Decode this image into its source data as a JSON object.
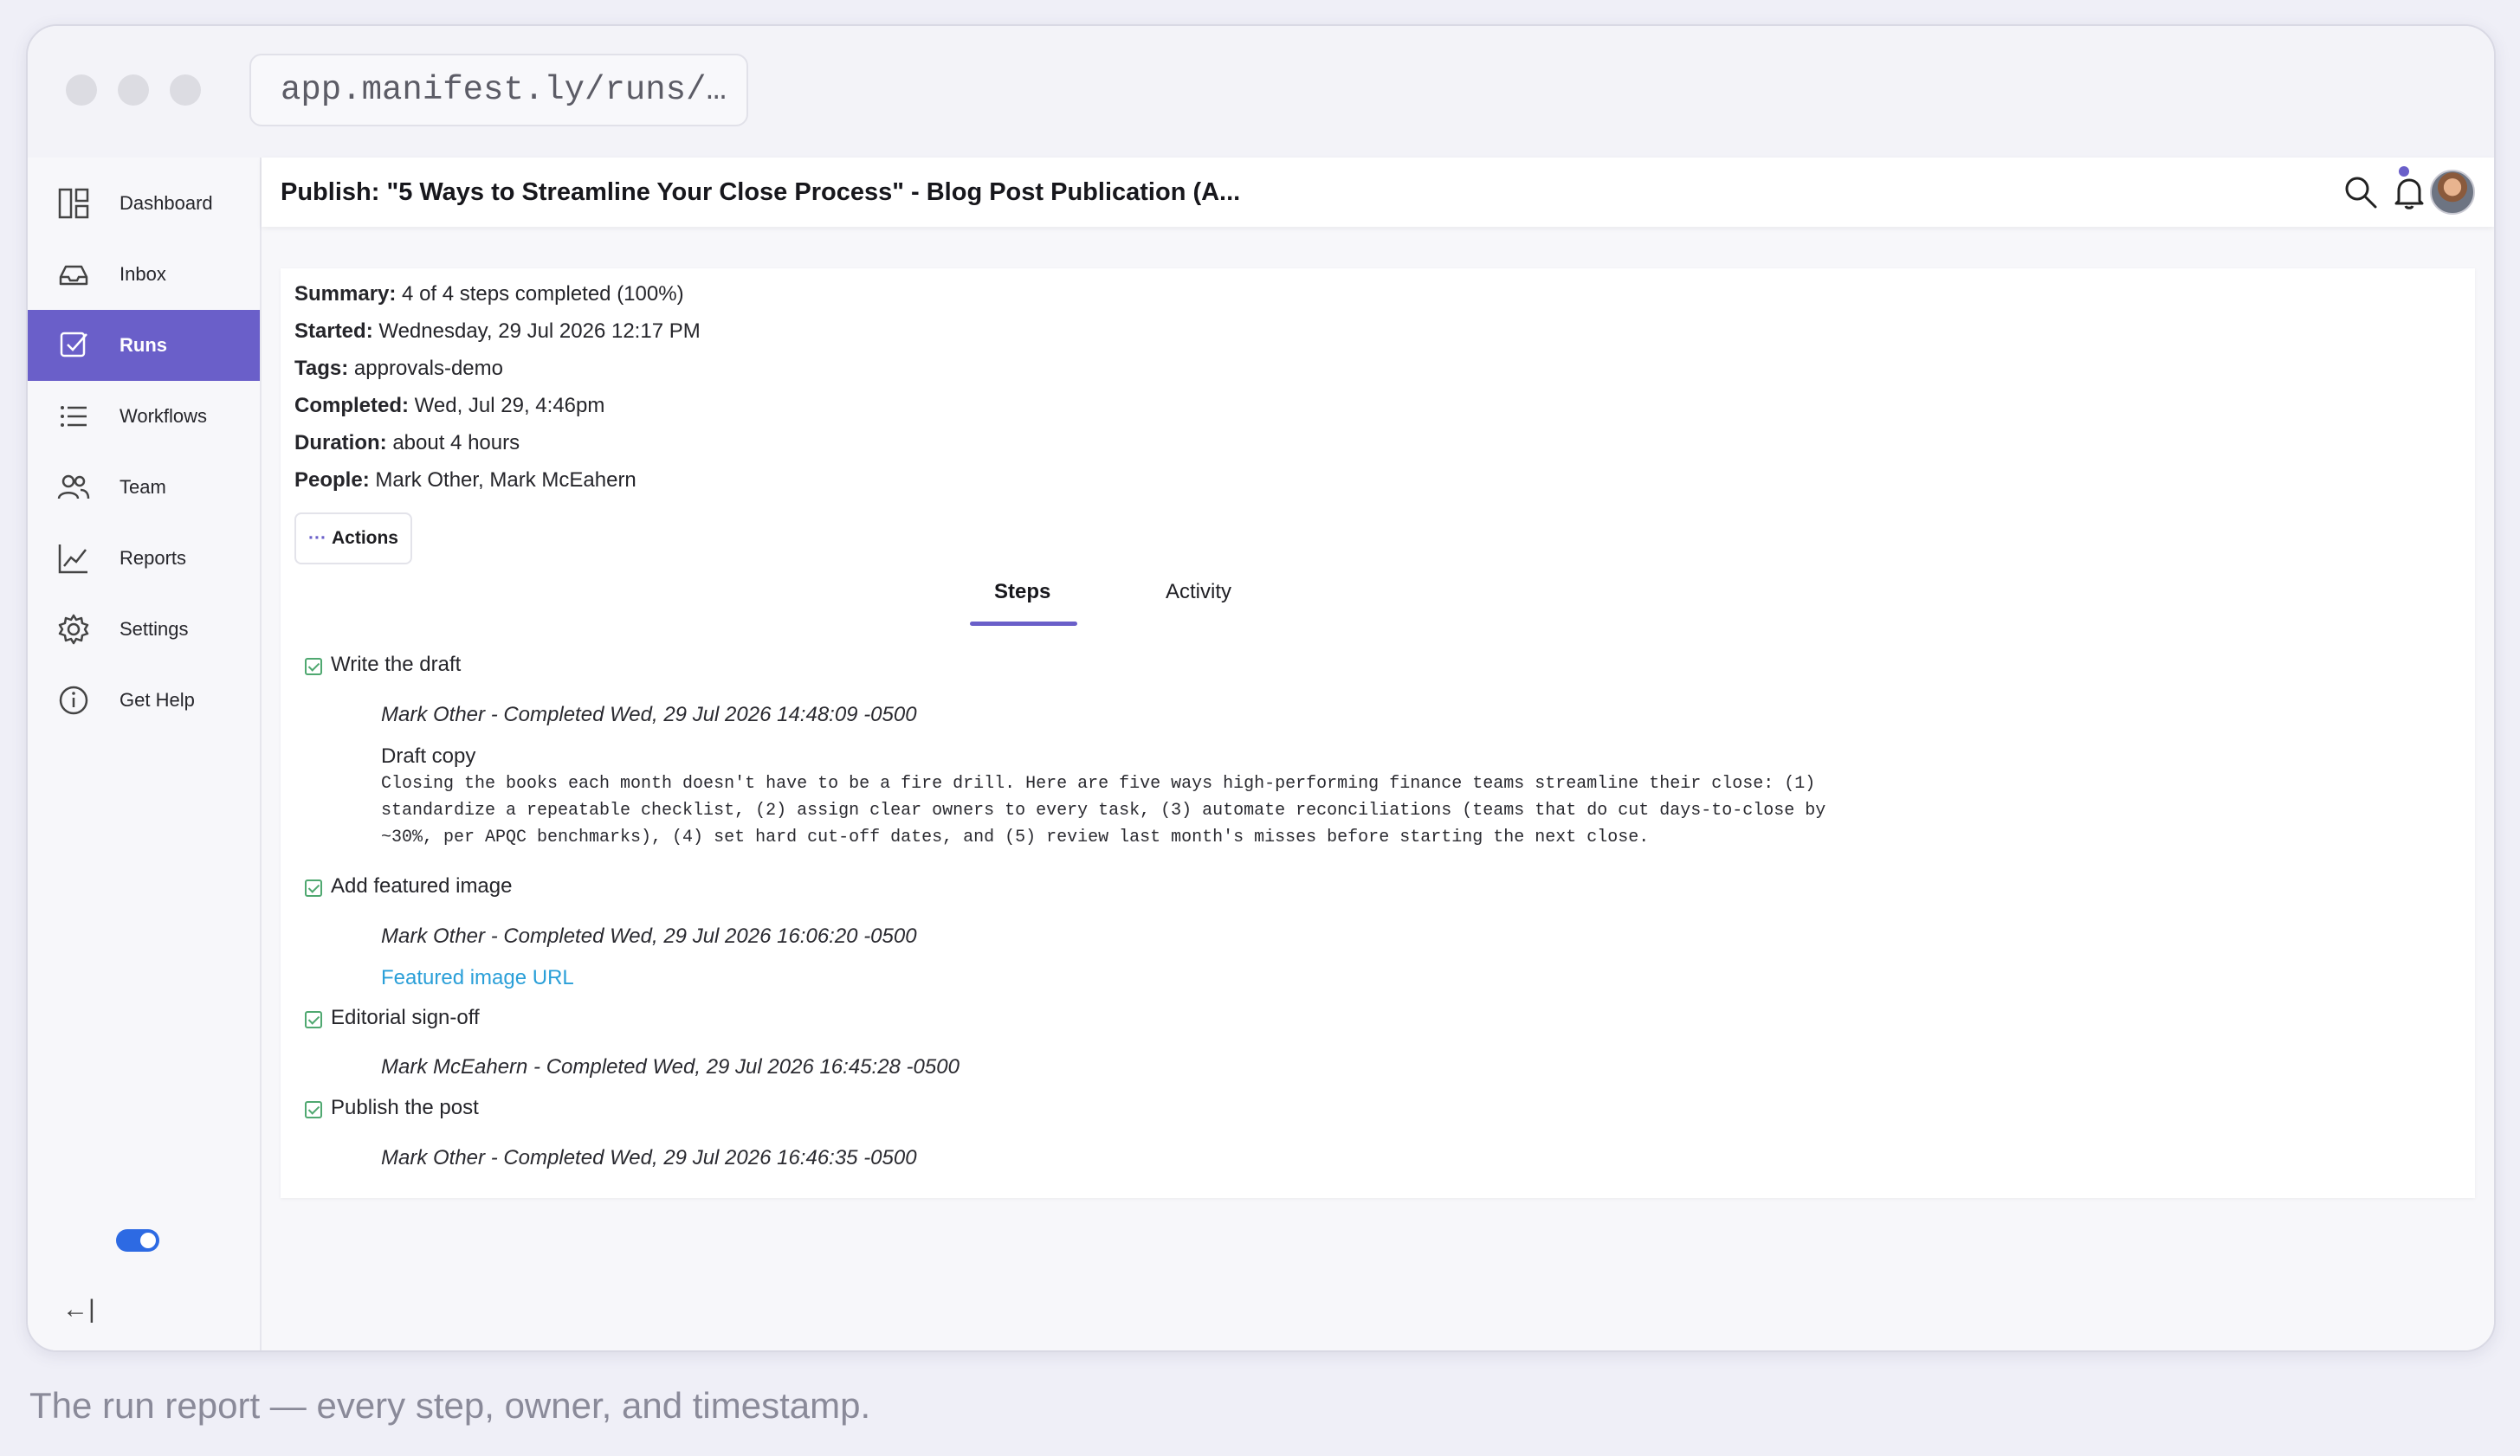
{
  "browser": {
    "url": "app.manifest.ly/runs/…"
  },
  "sidebar": {
    "items": [
      {
        "label": "Dashboard",
        "icon": "dashboard-icon"
      },
      {
        "label": "Inbox",
        "icon": "inbox-icon"
      },
      {
        "label": "Runs",
        "icon": "checkbox-icon",
        "active": true
      },
      {
        "label": "Workflows",
        "icon": "list-icon"
      },
      {
        "label": "Team",
        "icon": "team-icon"
      },
      {
        "label": "Reports",
        "icon": "chart-icon"
      },
      {
        "label": "Settings",
        "icon": "gear-icon"
      },
      {
        "label": "Get Help",
        "icon": "info-icon"
      }
    ],
    "collapse_icon": "←|"
  },
  "header": {
    "title": "Publish: \"5 Ways to Streamline Your Close Process\" - Blog Post Publication (A..."
  },
  "summary": {
    "summary": {
      "label": "Summary:",
      "value": "4 of 4 steps completed (100%)"
    },
    "started": {
      "label": "Started:",
      "value": "Wednesday, 29 Jul 2026 12:17 PM"
    },
    "tags": {
      "label": "Tags:",
      "value": "approvals-demo"
    },
    "completed": {
      "label": "Completed:",
      "value": "Wed, Jul 29, 4:46pm"
    },
    "duration": {
      "label": "Duration:",
      "value": "about 4 hours"
    },
    "people": {
      "label": "People:",
      "value": "Mark Other, Mark McEahern"
    }
  },
  "actions": {
    "dots": "···",
    "label": "Actions"
  },
  "tabs": [
    {
      "label": "Steps",
      "active": true
    },
    {
      "label": "Activity",
      "active": false
    }
  ],
  "steps": [
    {
      "title": "Write the draft",
      "completion": "Mark Other - Completed Wed, 29 Jul 2026 14:48:09 -0500",
      "field_label": "Draft copy",
      "field_text": "Closing the books each month doesn't have to be a fire drill. Here are five ways high-performing finance teams streamline their close: (1)\nstandardize a repeatable checklist, (2) assign clear owners to every task, (3) automate reconciliations (teams that do cut days-to-close by\n~30%, per APQC benchmarks), (4) set hard cut-off dates, and (5) review last month's misses before starting the next close."
    },
    {
      "title": "Add featured image",
      "completion": "Mark Other - Completed Wed, 29 Jul 2026 16:06:20 -0500",
      "link": "Featured image URL"
    },
    {
      "title": "Editorial sign-off",
      "completion": "Mark McEahern - Completed Wed, 29 Jul 2026 16:45:28 -0500"
    },
    {
      "title": "Publish the post",
      "completion": "Mark Other - Completed Wed, 29 Jul 2026 16:46:35 -0500"
    }
  ],
  "caption": "The run report — every step, owner, and timestamp.",
  "colors": {
    "accent": "#6a5fc9",
    "check": "#4fa870",
    "link": "#2a9fd8",
    "toggle": "#2d6ae3"
  }
}
